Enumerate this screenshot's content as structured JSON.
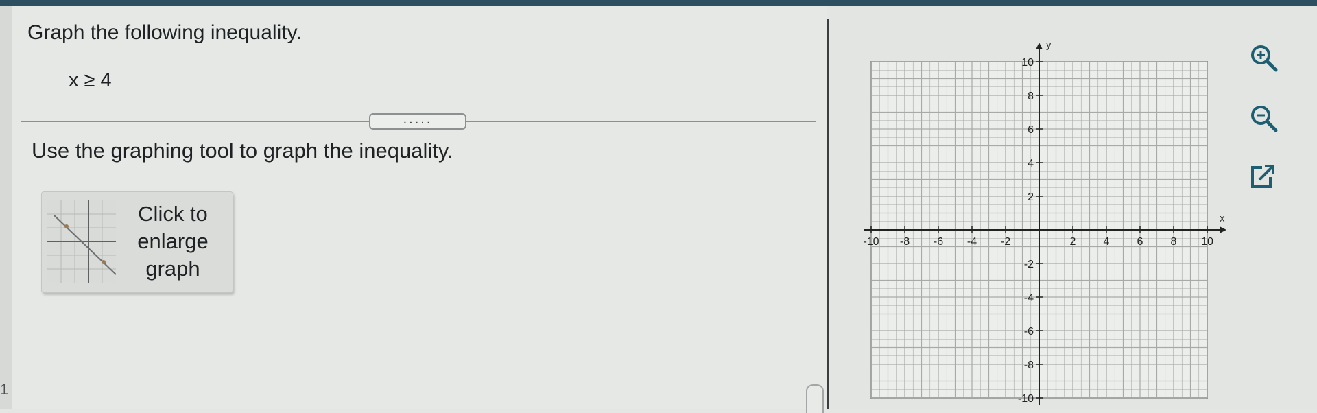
{
  "question": {
    "title": "Graph the following inequality.",
    "inequality": "x ≥ 4"
  },
  "divider": {
    "more_label": "....."
  },
  "instruction": "Use the graphing tool to graph the inequality.",
  "enlarge": {
    "line1": "Click to",
    "line2": "enlarge",
    "line3": "graph"
  },
  "graph": {
    "x_label": "x",
    "y_label": "y",
    "xlim": [
      -10,
      10
    ],
    "ylim": [
      -10,
      10
    ],
    "grid": true,
    "x_ticks": [
      -10,
      -8,
      -6,
      -4,
      -2,
      2,
      4,
      6,
      8,
      10
    ],
    "y_ticks": [
      10,
      8,
      6,
      4,
      2,
      -2,
      -4,
      -6,
      -8,
      -10
    ]
  },
  "tools": {
    "zoom_in": "zoom-in-icon",
    "zoom_out": "zoom-out-icon",
    "popout": "external-link-icon"
  },
  "page_number": "1",
  "colors": {
    "topbar": "#2d4f5f",
    "axis": "#222222",
    "grid": "#a8aaa8",
    "tool_icon": "#1e5e73"
  }
}
